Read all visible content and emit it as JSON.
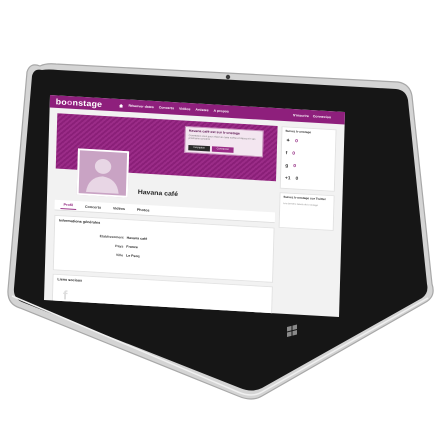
{
  "topbar": {
    "logo": "boonstage",
    "nav": [
      "Réserver dates",
      "Concerts",
      "Vidéos",
      "Artistes",
      "A propos"
    ],
    "signin": [
      "S'inscrire",
      "Connexion"
    ]
  },
  "banner": {
    "title": "Havana café est sur b-onstage",
    "subtitle": "Connectez-vous pour réserver cette scène et découvrir ses prochains concerts",
    "btn_inscription": "Inscription",
    "btn_connexion": "Connexion"
  },
  "profile": {
    "name": "Havana café"
  },
  "tabs": [
    "Profil",
    "Concerts",
    "Vidéos",
    "Photos"
  ],
  "info": {
    "heading": "Informations générales",
    "rows": [
      {
        "k": "Etablissement",
        "v": "Havana café"
      },
      {
        "k": "Pays",
        "v": "France"
      },
      {
        "k": "Ville",
        "v": "Le Pecq"
      }
    ]
  },
  "links": {
    "heading": "Liens sociaux"
  },
  "side": {
    "box1_heading": "Suivez b-onstage",
    "twitter_count": "0",
    "facebook_count": "0",
    "google_count": "0",
    "gplus_label": "0",
    "box2_heading": "Suivez b-onstage sur Twitter",
    "box2_text": "Les derniers tweets de b-onstage"
  },
  "colors": {
    "brand": "#8e1f7c",
    "tablet_body": "#1b1b1b",
    "tablet_frame": "#c9c9c9"
  },
  "icons": [
    "home-icon",
    "facebook-icon",
    "twitter-icon",
    "google-plus-icon",
    "windows-icon",
    "camera-icon"
  ]
}
